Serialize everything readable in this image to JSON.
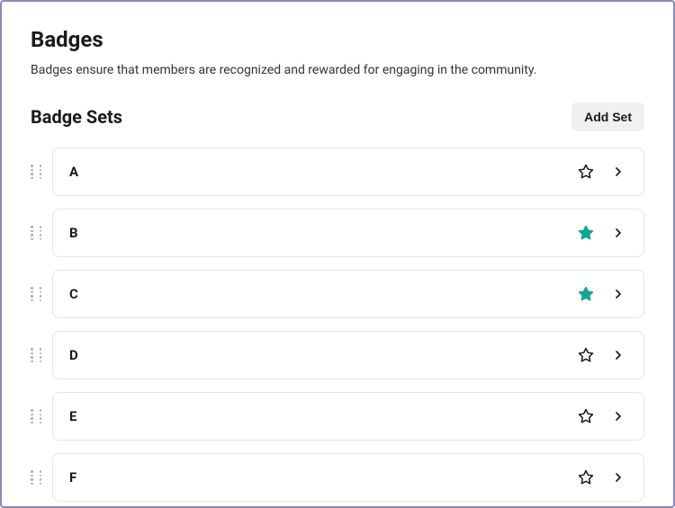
{
  "page": {
    "title": "Badges",
    "description": "Badges ensure that members are recognized and rewarded for engaging in the community."
  },
  "section": {
    "title": "Badge Sets",
    "add_button_label": "Add Set"
  },
  "colors": {
    "star_filled": "#16a394",
    "star_outline": "#1a1a1a",
    "chevron": "#1a1a1a"
  },
  "badge_sets": [
    {
      "label": "A",
      "favorited": false
    },
    {
      "label": "B",
      "favorited": true
    },
    {
      "label": "C",
      "favorited": true
    },
    {
      "label": "D",
      "favorited": false
    },
    {
      "label": "E",
      "favorited": false
    },
    {
      "label": "F",
      "favorited": false
    }
  ]
}
